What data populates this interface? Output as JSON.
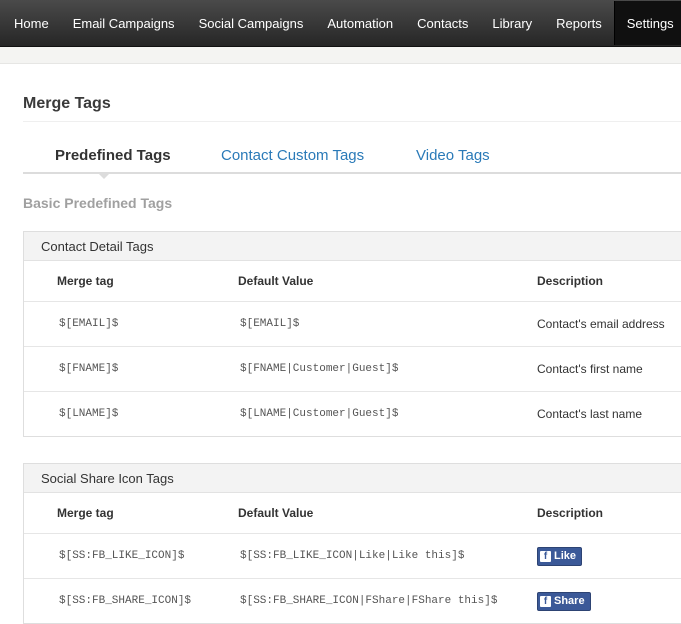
{
  "nav": {
    "items": [
      "Home",
      "Email Campaigns",
      "Social Campaigns",
      "Automation",
      "Contacts",
      "Library",
      "Reports",
      "Settings"
    ],
    "active": "Settings"
  },
  "page": {
    "title": "Merge Tags",
    "section_heading": "Basic Predefined Tags"
  },
  "tabs": [
    {
      "label": "Predefined Tags",
      "active": true
    },
    {
      "label": "Contact Custom Tags",
      "active": false
    },
    {
      "label": "Video Tags",
      "active": false
    }
  ],
  "tables": {
    "contact": {
      "title": "Contact Detail Tags",
      "columns": [
        "Merge tag",
        "Default Value",
        "Description"
      ],
      "rows": [
        {
          "tag": "$[EMAIL]$",
          "default": "$[EMAIL]$",
          "description": "Contact's email address"
        },
        {
          "tag": "$[FNAME]$",
          "default": "$[FNAME|Customer|Guest]$",
          "description": "Contact's first name"
        },
        {
          "tag": "$[LNAME]$",
          "default": "$[LNAME|Customer|Guest]$",
          "description": "Contact's last name"
        }
      ]
    },
    "social": {
      "title": "Social Share Icon Tags",
      "columns": [
        "Merge tag",
        "Default Value",
        "Description"
      ],
      "rows": [
        {
          "tag": "$[SS:FB_LIKE_ICON]$",
          "default": "$[SS:FB_LIKE_ICON|Like|Like this]$",
          "button_label": "Like",
          "icon": "facebook-icon"
        },
        {
          "tag": "$[SS:FB_SHARE_ICON]$",
          "default": "$[SS:FB_SHARE_ICON|FShare|FShare this]$",
          "button_label": "Share",
          "icon": "facebook-icon"
        }
      ]
    }
  },
  "colors": {
    "nav_bg": "#2f2f2f",
    "nav_active_bg": "#101010",
    "link": "#2a7ab8",
    "facebook": "#3b5998"
  }
}
